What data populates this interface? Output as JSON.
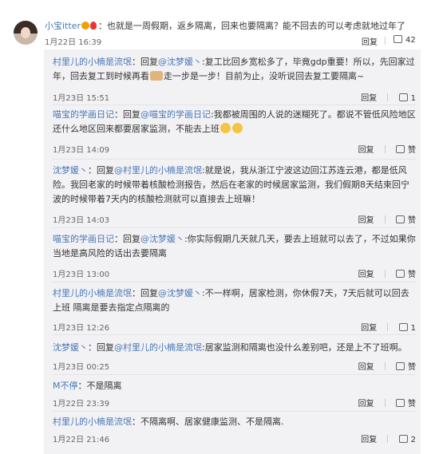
{
  "top_comment": {
    "user": "小宝itter",
    "separator": "：",
    "text": "也就是一周假期，返乡隔离，回来也要隔离？能不回去的可以考虑就地过年了",
    "time": "1月22日 16:39",
    "reply_label": "回复",
    "likes": "42"
  },
  "replies": [
    {
      "user": "村里儿的小楠是流氓",
      "colon": "：回复",
      "target": "@沈梦媛丶",
      "text1": ":复工比回乡宽松多了，毕竟gdp重要！所以，先回家过年，回去复工到时候再看",
      "text2": "走一步是一步！目前为止，没听说回去复工要隔离~",
      "time": "1月23日 15:51",
      "reply_label": "回复",
      "likes": "1"
    },
    {
      "user": "喵宝的学画日记",
      "colon": "：回复",
      "target": "@喵宝的学画日记",
      "text1": ":我都被周围的人说的迷糊死了。都说不管低风险地区还什么地区回来都要居家监测，不能去上班",
      "text2": "",
      "time": "1月23日 14:09",
      "reply_label": "回复",
      "likes": "赞"
    },
    {
      "user": "沈梦媛丶",
      "colon": "：回复",
      "target": "@村里儿的小楠是流氓",
      "text1": ":就是说，我从浙江宁波这边回江苏连云港，都是低风险。我回老家的时候带着核酸检测报告，然后在老家的时候居家监测，我们假期8天结束回宁波的时候带着7天内的核酸检测就可以直接去上班嘛！",
      "text2": "",
      "time": "1月23日 14:03",
      "reply_label": "回复",
      "likes": "赞"
    },
    {
      "user": "喵宝的学画日记",
      "colon": "：回复",
      "target": "@沈梦媛丶",
      "text1": ":你实际假期几天就几天，要去上班就可以去了，不过如果你当地是高风险的话出去要隔离",
      "text2": "",
      "time": "1月23日 13:00",
      "reply_label": "回复",
      "likes": "赞"
    },
    {
      "user": "村里儿的小楠是流氓",
      "colon": "：回复",
      "target": "@沈梦媛丶",
      "text1": ":不一样啊，居家检测，你休假7天，7天后就可以回去上班 隔离是要去指定点隔离的",
      "text2": "",
      "time": "1月23日 12:26",
      "reply_label": "回复",
      "likes": "1"
    },
    {
      "user": "沈梦媛丶",
      "colon": "：回复",
      "target": "@村里儿的小楠是流氓",
      "text1": ":居家监测和隔离也没什么差别吧，还是上不了班啊。",
      "text2": "",
      "time": "1月23日 00:25",
      "reply_label": "回复",
      "likes": "赞"
    },
    {
      "user": "M不停",
      "colon": "：",
      "target": "",
      "text1": "不是隔离",
      "text2": "",
      "time": "1月22日 23:39",
      "reply_label": "回复",
      "likes": "赞"
    },
    {
      "user": "村里儿的小楠是流氓",
      "colon": "：",
      "target": "",
      "text1": "不隔离啊、居家健康监测、不是隔离.",
      "text2": "",
      "time": "1月22日 21:46",
      "reply_label": "回复",
      "likes": "2"
    }
  ]
}
